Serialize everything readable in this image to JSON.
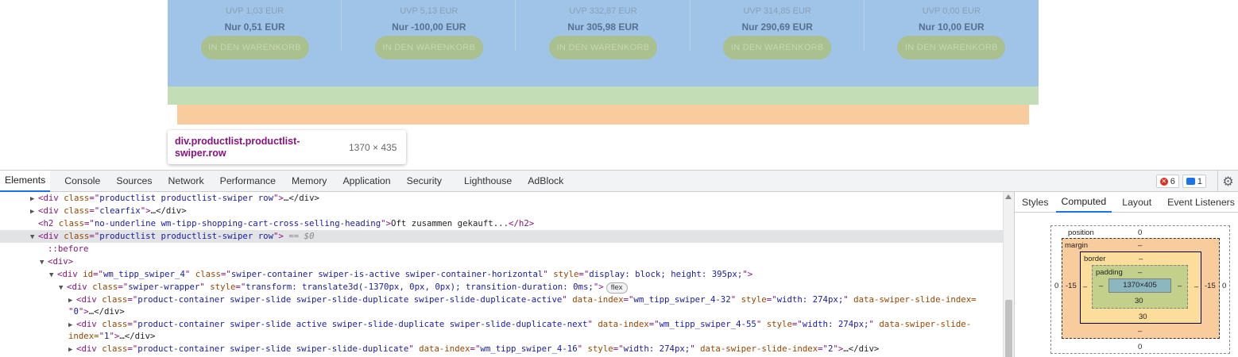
{
  "viewport": {
    "products": [
      {
        "uvp": "UVP 1,03 EUR",
        "price": "Nur 0,51 EUR",
        "button": "IN DEN WARENKORB"
      },
      {
        "uvp": "UVP 5,13 EUR",
        "price": "Nur -100,00 EUR",
        "button": "IN DEN WARENKORB"
      },
      {
        "uvp": "UVP 332,87 EUR",
        "price": "Nur 305,98 EUR",
        "button": "IN DEN WARENKORB"
      },
      {
        "uvp": "UVP 314,85 EUR",
        "price": "Nur 290,69 EUR",
        "button": "IN DEN WARENKORB"
      },
      {
        "uvp": "UVP 0,00 EUR",
        "price": "Nur 10,00 EUR",
        "button": "IN DEN WARENKORB"
      }
    ],
    "tooltip": {
      "name": "div.productlist.productlist-swiper.row",
      "size": "1370 × 435"
    },
    "colors": {
      "padding": "#9fc4e7",
      "border": "#c3deb7",
      "margin": "#f9cc9d"
    }
  },
  "devtools": {
    "tabs": [
      "Elements",
      "Console",
      "Sources",
      "Network",
      "Performance",
      "Memory",
      "Application",
      "Security",
      "Lighthouse",
      "AdBlock"
    ],
    "active_tab": "Elements",
    "error_count": "6",
    "message_count": "1",
    "side_tabs": [
      "Styles",
      "Computed",
      "Layout",
      "Event Listeners"
    ],
    "active_side_tab": "Computed",
    "dom": {
      "l1": {
        "tag": "div",
        "attr": "class",
        "val": "productlist productlist-swiper row",
        "rest": "…</div>"
      },
      "l2": {
        "tag": "div",
        "attr": "class",
        "val": "clearfix",
        "rest": "…</div>"
      },
      "l3": {
        "tag": "h2",
        "attr": "class",
        "val": "no-underline wm-tipp-shopping-cart-cross-selling-heading",
        "text": "Oft zusammen gekauft...",
        "close": "</h2>"
      },
      "l4": {
        "tag": "div",
        "attr": "class",
        "val": "productlist productlist-swiper row",
        "ref": "== $0"
      },
      "l5": {
        "pseudo": "::before"
      },
      "l6": {
        "tag": "div"
      },
      "l7": {
        "tag": "div",
        "attr1": "id",
        "val1": "wm_tipp_swiper_4",
        "attr2": "class",
        "val2": "swiper-container swiper-is-active swiper-container-horizontal",
        "attr3": "style",
        "val3": "display: block; height: 395px;"
      },
      "l8": {
        "tag": "div",
        "attr1": "class",
        "val1": "swiper-wrapper",
        "attr2": "style",
        "val2": "transform: translate3d(-1370px, 0px, 0px); transition-duration: 0ms;",
        "badge": "flex"
      },
      "l9": {
        "tag": "div",
        "attr1": "class",
        "val1": "product-container swiper-slide swiper-slide-duplicate swiper-slide-duplicate-active",
        "attr2": "data-index",
        "val2": "wm_tipp_swiper_4-32",
        "attr3": "style",
        "val3": "width: 274px;",
        "attr4": "data-swiper-slide-index=",
        "wrap": "0",
        "rest": "…</div>"
      },
      "l10": {
        "tag": "div",
        "attr1": "class",
        "val1": "product-container swiper-slide active swiper-slide-duplicate swiper-slide-duplicate-next",
        "attr2": "data-index",
        "val2": "wm_tipp_swiper_4-55",
        "attr3": "style",
        "val3": "width: 274px;",
        "attr4": "data-swiper-slide-",
        "wrap_prefix": "index=",
        "wrap": "1",
        "rest": "…</div>"
      },
      "l11": {
        "tag": "div",
        "attr1": "class",
        "val1": "product-container swiper-slide swiper-slide-duplicate",
        "attr2": "data-index",
        "val2": "wm_tipp_swiper_4-16",
        "attr3": "style",
        "val3": "width: 274px;",
        "attr4": "data-swiper-slide-index",
        "val4": "2",
        "rest": "…</div>"
      }
    },
    "box_model": {
      "position_label": "position",
      "position_top": "0",
      "position_bottom": "0",
      "position_left": "0",
      "position_right": "0",
      "margin_label": "margin",
      "margin_top": "–",
      "margin_bottom": "–",
      "margin_left": "-15",
      "margin_right": "-15",
      "border_label": "border",
      "border_top": "–",
      "border_bottom": "30",
      "border_left": "–",
      "border_right": "–",
      "padding_label": "padding",
      "padding_top": "–",
      "padding_bottom": "30",
      "padding_left": "–",
      "padding_right": "–",
      "content": "1370×405"
    }
  }
}
